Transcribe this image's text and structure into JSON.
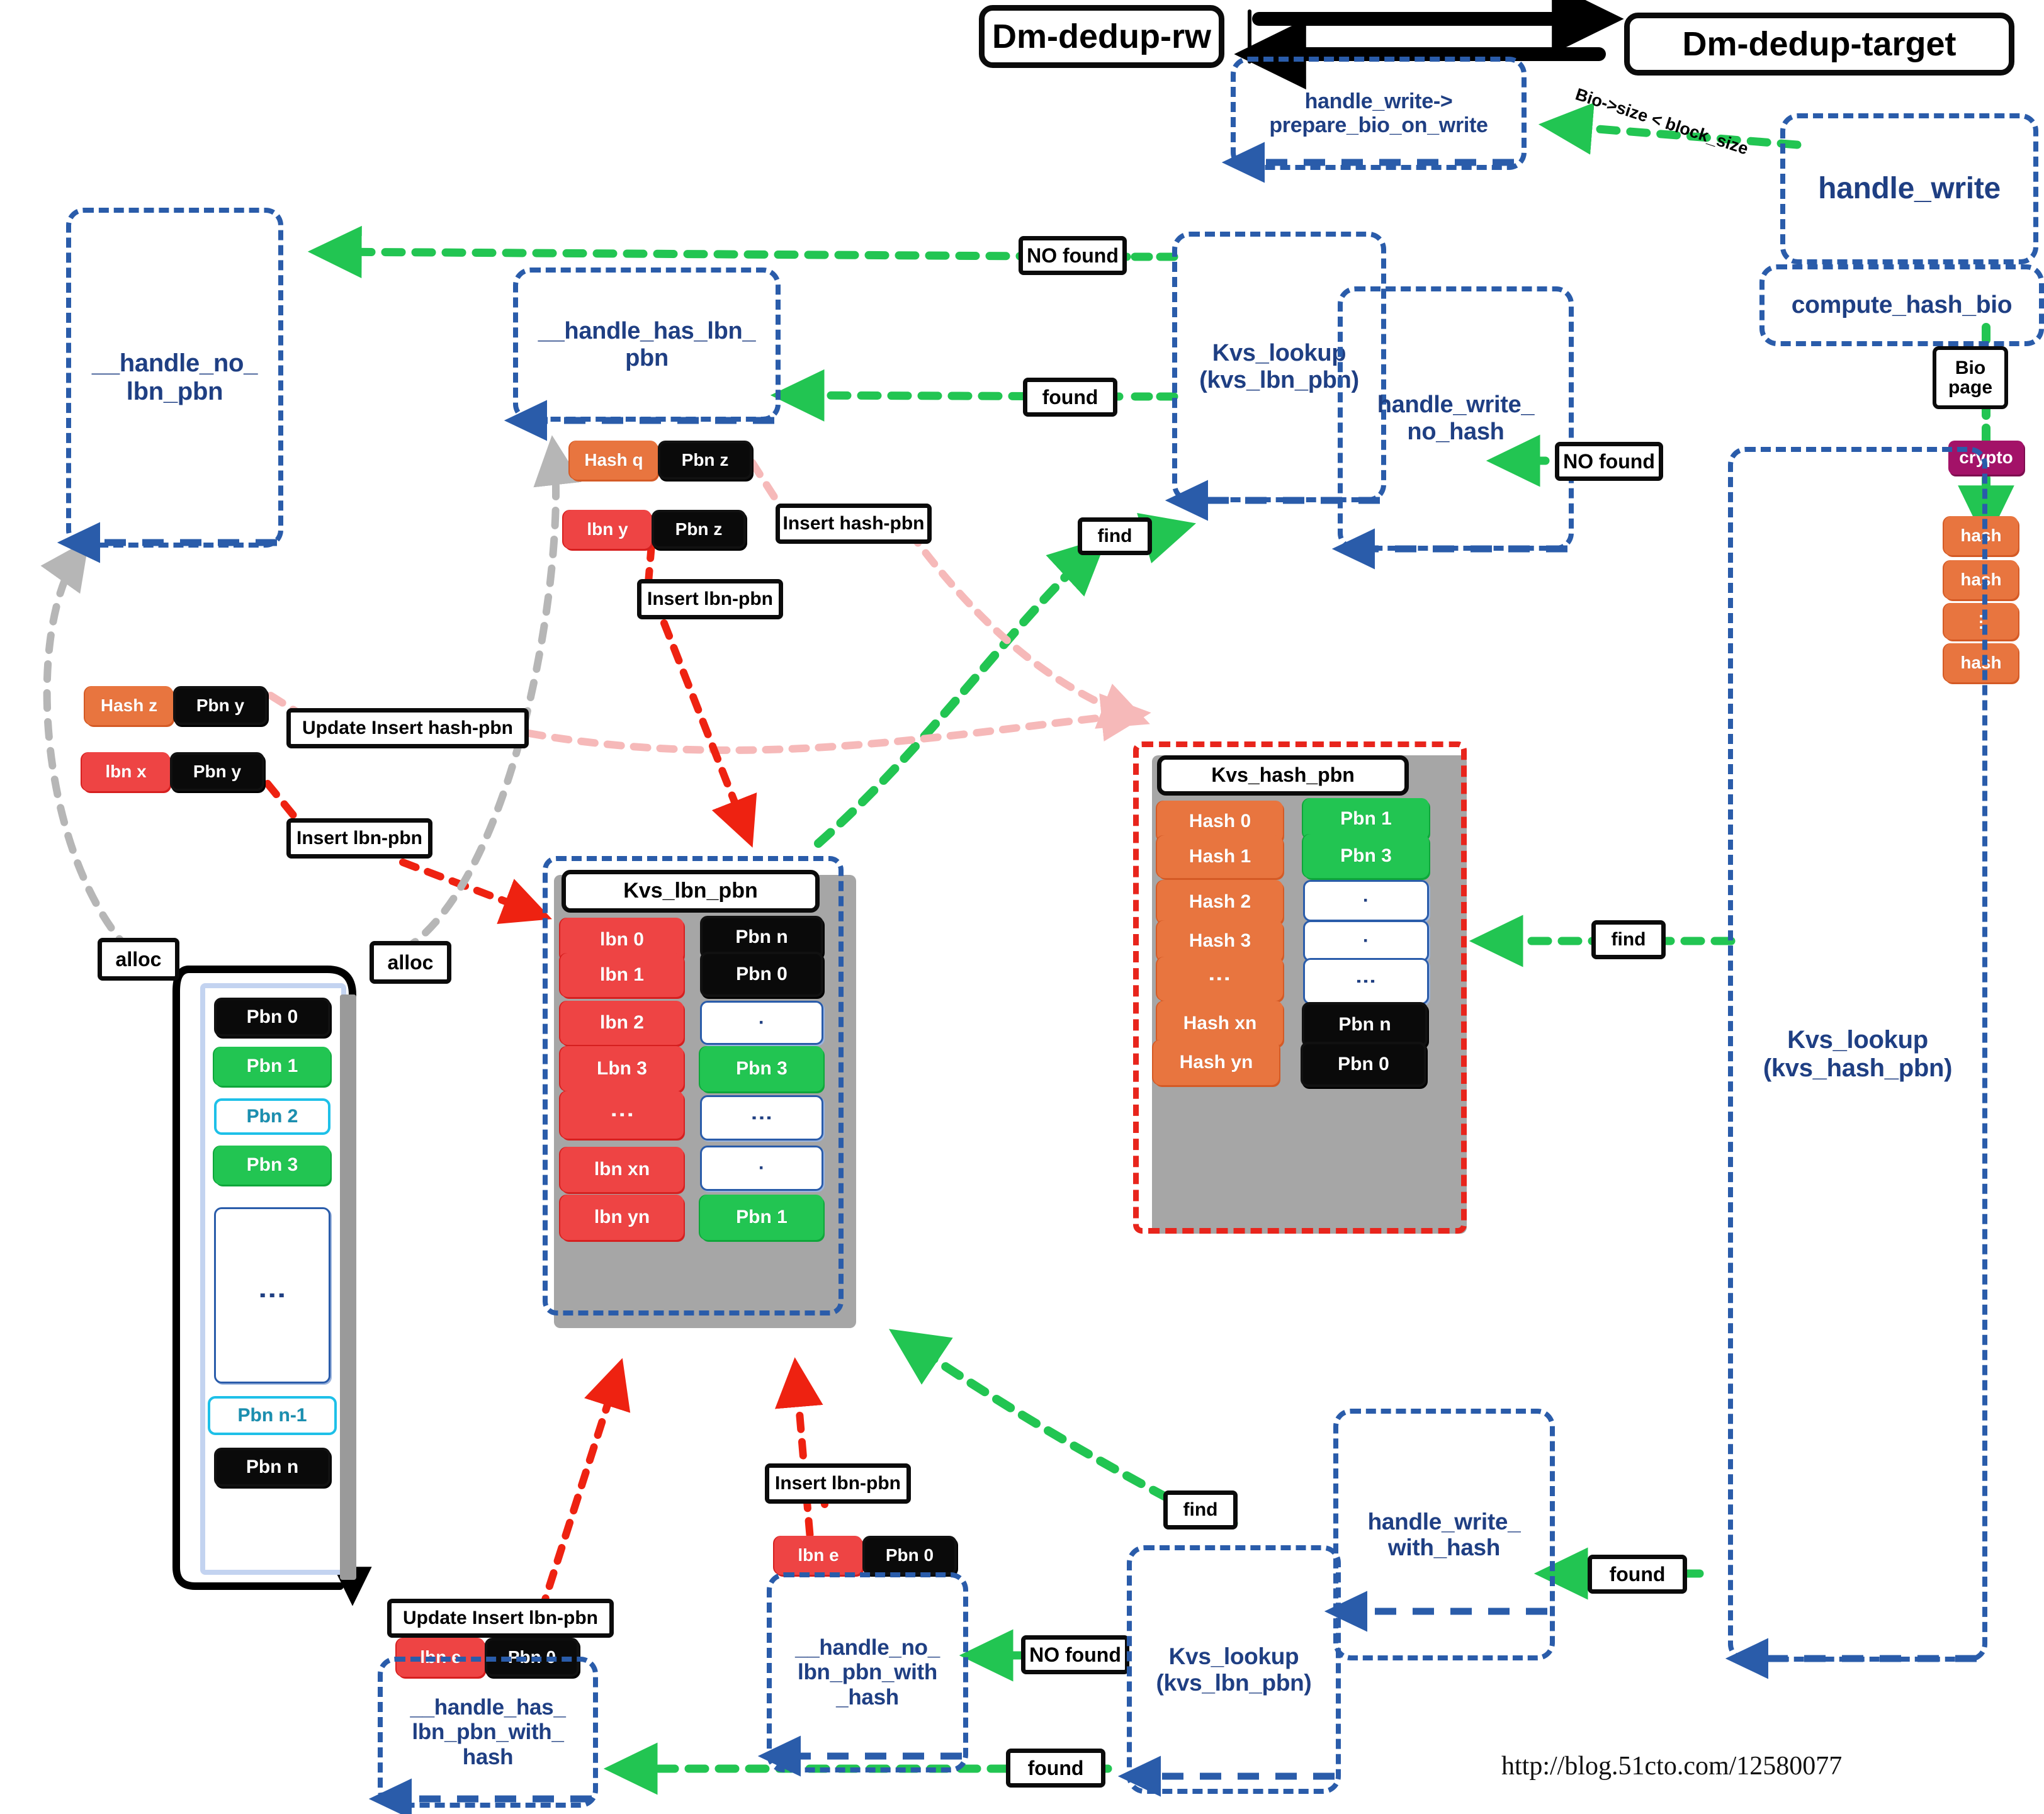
{
  "diagram": {
    "title_left": "Dm-dedup-rw",
    "title_right": "Dm-dedup-target",
    "watermark": "http://blog.51cto.com/12580077",
    "colors": {
      "blue_func": "#1f3f83",
      "blue_dash": "#2a5caa",
      "red_key": "#ee4444",
      "orange_key": "#e8753f",
      "green_val": "#22c552",
      "black_val": "#0a0a0a",
      "cyan_val": "#1ec0e8",
      "crypto": "#a31268",
      "green_arrow": "#22c552",
      "red_arrow": "#ee2211",
      "pink_arrow": "#f7bcbc",
      "gray_arrow": "#b6b6b6"
    }
  },
  "functions": {
    "handle_write_prepare": "handle_write->\nprepare_bio_on_write",
    "handle_write_prepare_l1": "handle_write->",
    "handle_write_prepare_l2": "prepare_bio_on_write",
    "handle_write": "handle_write",
    "compute_hash_bio": "compute_hash_bio",
    "handle_no_lbn_pbn_l1": "__handle_no_",
    "handle_no_lbn_pbn_l2": "lbn_pbn",
    "handle_has_lbn_pbn_l1": "__handle_has_lbn_",
    "handle_has_lbn_pbn_l2": "pbn",
    "kvs_lookup_lbn_l1": "Kvs_lookup",
    "kvs_lookup_lbn_l2": "(kvs_lbn_pbn)",
    "handle_write_no_hash_l1": "handle_write_",
    "handle_write_no_hash_l2": "no_hash",
    "kvs_lookup_hash_l1": "Kvs_lookup",
    "kvs_lookup_hash_l2": "(kvs_hash_pbn)",
    "handle_write_with_hash_l1": "handle_write_",
    "handle_write_with_hash_l2": "with_hash",
    "kvs_lookup_lbn2_l1": "Kvs_lookup",
    "kvs_lookup_lbn2_l2": "(kvs_lbn_pbn)",
    "handle_no_lbn_pbn_with_hash_l1": "__handle_no_",
    "handle_no_lbn_pbn_with_hash_l2": "lbn_pbn_with",
    "handle_no_lbn_pbn_with_hash_l3": "_hash",
    "handle_has_lbn_pbn_with_hash_l1": "__handle_has_",
    "handle_has_lbn_pbn_with_hash_l2": "lbn_pbn_with_",
    "handle_has_lbn_pbn_with_hash_l3": "hash"
  },
  "edge_labels": {
    "bio_size": "Bio->size < block_size",
    "no_found_top": "NO found",
    "found_top": "found",
    "no_found_right": "NO found",
    "find_top": "find",
    "find_mid": "find",
    "find_bottom": "find",
    "found_bottom_right": "found",
    "no_found_bottom": "NO found",
    "found_bottom": "found",
    "insert_hash_pbn": "Insert hash-pbn",
    "insert_lbn_pbn_top": "Insert lbn-pbn",
    "update_insert_hash_pbn": "Update Insert hash-pbn",
    "insert_lbn_pbn_left": "Insert lbn-pbn",
    "insert_lbn_pbn_bottom": "Insert lbn-pbn",
    "update_insert_lbn_pbn": "Update Insert lbn-pbn",
    "alloc_left": "alloc",
    "alloc_right": "alloc"
  },
  "bio_pipeline": {
    "bio_page_l1": "Bio",
    "bio_page_l2": "page",
    "crypto": "crypto",
    "hashes": [
      "hash",
      "hash",
      "⋮",
      "hash"
    ]
  },
  "pairs": {
    "hash_q_pbn_z": {
      "key": "Hash q",
      "value": "Pbn z"
    },
    "lbn_y_pbn_z": {
      "key": "lbn y",
      "value": "Pbn z"
    },
    "hash_z_pbn_y": {
      "key": "Hash z",
      "value": "Pbn y"
    },
    "lbn_x_pbn_y": {
      "key": "lbn x",
      "value": "Pbn y"
    },
    "lbn_e_pbn_0_a": {
      "key": "lbn e",
      "value": "Pbn 0"
    },
    "lbn_e_pbn_0_b": {
      "key": "lbn e",
      "value": "Pbn 0"
    }
  },
  "pbn_pool": {
    "items": [
      {
        "label": "Pbn 0",
        "style": "black"
      },
      {
        "label": "Pbn 1",
        "style": "green"
      },
      {
        "label": "Pbn 2",
        "style": "cyan"
      },
      {
        "label": "Pbn 3",
        "style": "green"
      },
      {
        "label": "⋮",
        "style": "empty"
      },
      {
        "label": "Pbn n-1",
        "style": "cyan"
      },
      {
        "label": "Pbn n",
        "style": "black"
      }
    ]
  },
  "chart_data": {
    "type": "table",
    "tables": [
      {
        "name": "Kvs_lbn_pbn",
        "title": "Kvs_lbn_pbn",
        "columns": [
          "key",
          "value"
        ],
        "rows": [
          {
            "key": "lbn 0",
            "key_style": "red",
            "value": "Pbn n",
            "value_style": "black"
          },
          {
            "key": "lbn 1",
            "key_style": "red",
            "value": "Pbn 0",
            "value_style": "black"
          },
          {
            "key": "lbn 2",
            "key_style": "red",
            "value": "·",
            "value_style": "empty"
          },
          {
            "key": "Lbn 3",
            "key_style": "red",
            "value": "Pbn 3",
            "value_style": "green"
          },
          {
            "key": "⋮",
            "key_style": "red",
            "value": "⋮",
            "value_style": "empty"
          },
          {
            "key": "lbn xn",
            "key_style": "red",
            "value": "·",
            "value_style": "empty"
          },
          {
            "key": "lbn yn",
            "key_style": "red",
            "value": "Pbn 1",
            "value_style": "green"
          }
        ]
      },
      {
        "name": "Kvs_hash_pbn",
        "title": "Kvs_hash_pbn",
        "columns": [
          "key",
          "value"
        ],
        "rows": [
          {
            "key": "Hash 0",
            "key_style": "orange",
            "value": "Pbn 1",
            "value_style": "green"
          },
          {
            "key": "Hash 1",
            "key_style": "orange",
            "value": "Pbn 3",
            "value_style": "green"
          },
          {
            "key": "Hash 2",
            "key_style": "orange",
            "value": "·",
            "value_style": "empty"
          },
          {
            "key": "Hash 3",
            "key_style": "orange",
            "value": "·",
            "value_style": "empty"
          },
          {
            "key": "⋮",
            "key_style": "orange",
            "value": "⋮",
            "value_style": "empty"
          },
          {
            "key": "Hash xn",
            "key_style": "orange",
            "value": "Pbn n",
            "value_style": "black"
          },
          {
            "key": "Hash yn",
            "key_style": "orange",
            "value": "Pbn 0",
            "value_style": "black"
          }
        ]
      }
    ]
  }
}
